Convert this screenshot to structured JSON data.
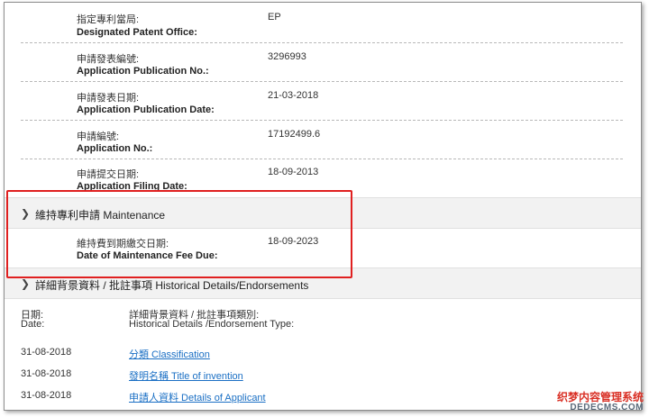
{
  "patent_details": [
    {
      "label_zh": "指定專利當局:",
      "label_en": "Designated Patent Office:",
      "value": "EP"
    },
    {
      "label_zh": "申請發表編號:",
      "label_en": "Application Publication No.:",
      "value": "3296993"
    },
    {
      "label_zh": "申請發表日期:",
      "label_en": "Application Publication Date:",
      "value": "21-03-2018"
    },
    {
      "label_zh": "申請編號:",
      "label_en": "Application No.:",
      "value": "17192499.6"
    },
    {
      "label_zh": "申請提交日期:",
      "label_en": "Application Filing Date:",
      "value": "18-09-2013"
    }
  ],
  "maintenance": {
    "title": "維持專利申請 Maintenance",
    "label_zh": "維持費到期繳交日期:",
    "label_en": "Date of Maintenance Fee Due:",
    "value": "18-09-2023"
  },
  "history": {
    "title": "詳細背景資料 / 批註事項 Historical Details/Endorsements",
    "col_date_zh": "日期:",
    "col_date_en": "Date:",
    "col_type_zh": "詳細背景資料 / 批註事項類別:",
    "col_type_en": "Historical Details /Endorsement Type:",
    "rows": [
      {
        "date": "31-08-2018",
        "type": "分類 Classification"
      },
      {
        "date": "31-08-2018",
        "type": "發明名稱 Title of invention"
      },
      {
        "date": "31-08-2018",
        "type": "申請人資料 Details of Applicant"
      }
    ]
  },
  "watermark": {
    "line1": "织梦内容管理系统",
    "line2": "DEDECMS.COM"
  },
  "colors": {
    "highlight_border": "#e02020",
    "link": "#1a6fc4",
    "section_bg": "#f2f2f2"
  },
  "icons": {
    "section_toggle": "chevron-right-icon"
  }
}
